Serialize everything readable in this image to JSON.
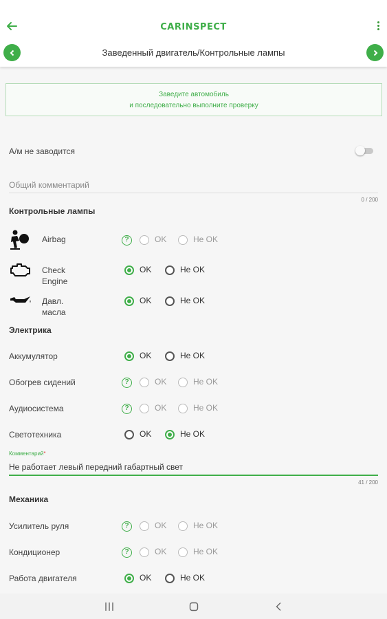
{
  "header": {
    "logo": "CARINSPECT",
    "title": "Заведенный двигатель/Контрольные лампы"
  },
  "hint": {
    "line1": "Заведите автомобиль",
    "line2": "и последовательно выполните проверку"
  },
  "not_starting": {
    "label": "А/м не заводится",
    "enabled": false
  },
  "general_comment": {
    "placeholder": "Общий комментарий",
    "counter": "0 / 200"
  },
  "options": {
    "ok": "OK",
    "not_ok": "Не OK"
  },
  "warning_lights": {
    "title": "Контрольные лампы",
    "items": [
      {
        "label": "Airbag",
        "icon": "airbag-icon",
        "state": "unset"
      },
      {
        "label": "Check\nEngine",
        "icon": "check-engine-icon",
        "state": "ok"
      },
      {
        "label": "Давл.\nмасла",
        "icon": "oil-pressure-icon",
        "state": "ok"
      }
    ]
  },
  "electrics": {
    "title": "Электрика",
    "items": [
      {
        "label": "Аккумулятор",
        "state": "ok"
      },
      {
        "label": "Обогрев сидений",
        "state": "unset"
      },
      {
        "label": "Аудиосистема",
        "state": "unset"
      },
      {
        "label": "Светотехника",
        "state": "not_ok"
      }
    ],
    "comment": {
      "label": "Комментарий",
      "required_mark": "*",
      "value": "Не работает левый передний габартный свет",
      "counter": "41 / 200"
    }
  },
  "mechanics": {
    "title": "Механика",
    "items": [
      {
        "label": "Усилитель руля",
        "state": "unset"
      },
      {
        "label": "Кондиционер",
        "state": "unset"
      },
      {
        "label": "Работа двигателя",
        "state": "ok"
      }
    ]
  },
  "system_nav": {
    "recents": "recents-icon",
    "home": "home-icon",
    "back": "back-icon"
  },
  "colors": {
    "accent": "#3fae49",
    "background": "#f6f6f6"
  }
}
